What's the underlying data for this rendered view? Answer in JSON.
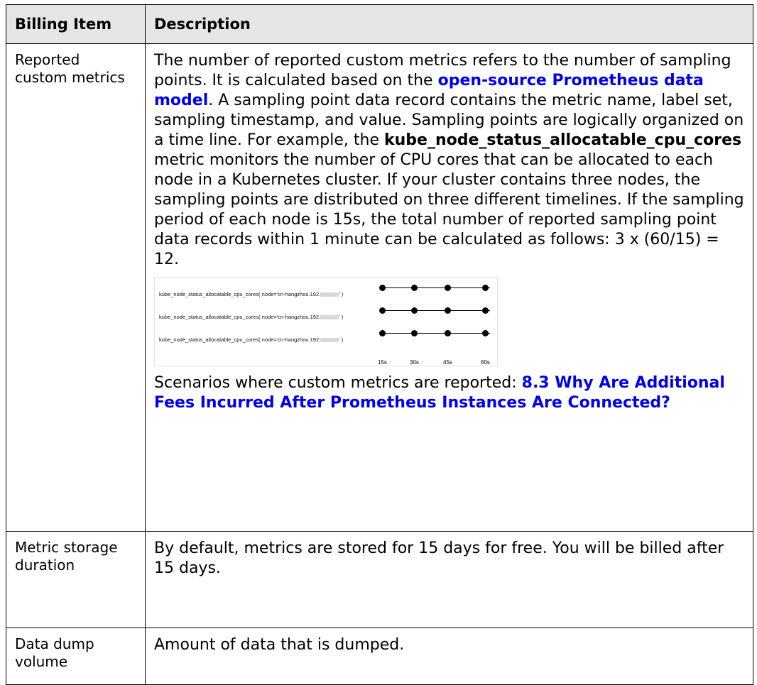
{
  "table": {
    "headers": [
      "Billing Item",
      "Description"
    ],
    "rows": [
      {
        "item": "Reported custom metrics",
        "desc": {
          "p1_a": "The number of reported custom metrics refers to the number of sampling points. It is calculated based on the ",
          "p1_link": "open-source Prometheus data model",
          "p1_b": ". A sampling point data record contains the metric name, label set, sampling timestamp, and value. Sampling points are logically organized on a time line. For example, the ",
          "p1_bold": "kube_node_status_allocatable_cpu_cores",
          "p1_c": " metric monitors the number of CPU cores that can be allocated to each node in a Kubernetes cluster. If your cluster contains three nodes, the sampling points are distributed on three different timelines. If the sampling period of each node is 15s, the total number of reported sampling point data records within 1 minute can be calculated as follows: 3 x (60/15) = 12.",
          "figure": {
            "series_labels": [
              "kube_node_status_allocatable_cpu_cores( node='cn-hangzhou.192.",
              "kube_node_status_allocatable_cpu_cores( node='cn-hangzhou.192.",
              "kube_node_status_allocatable_cpu_cores( node='cn-hangzhou.192."
            ],
            "label_suffix": "' )",
            "ticks": [
              "15s",
              "30s",
              "45s",
              "60s"
            ]
          },
          "p2_a": "Scenarios where custom metrics are reported: ",
          "p2_link": "8.3 Why Are Additional Fees Incurred After Prometheus Instances Are Connected?"
        }
      },
      {
        "item": "Metric storage duration",
        "desc_text": "By default, metrics are stored for 15 days for free. You will be billed after 15 days."
      },
      {
        "item": "Data dump volume",
        "desc_text": "Amount of data that is dumped."
      }
    ]
  }
}
